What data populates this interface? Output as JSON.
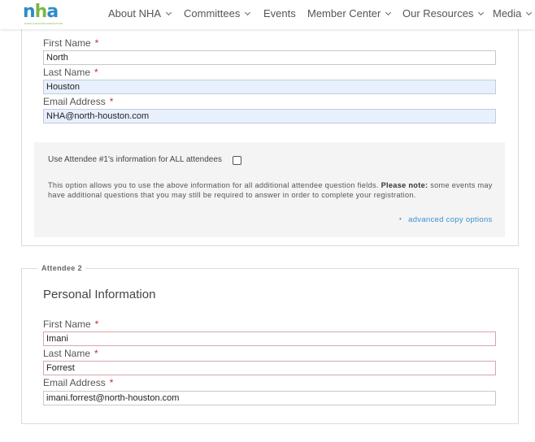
{
  "header": {
    "logo_text": "nha",
    "logo_subtext": "NORTH HOUSTON ASSOCIATION",
    "nav": [
      {
        "label": "About NHA",
        "has_dropdown": true
      },
      {
        "label": "Committees",
        "has_dropdown": true
      },
      {
        "label": "Events",
        "has_dropdown": false
      },
      {
        "label": "Member Center",
        "has_dropdown": true
      },
      {
        "label": "Our Resources",
        "has_dropdown": true
      },
      {
        "label": "Media",
        "has_dropdown": true
      }
    ]
  },
  "attendee1": {
    "first_name_label": "First Name",
    "first_name_value": "North",
    "last_name_label": "Last Name",
    "last_name_value": "Houston",
    "email_label": "Email Address",
    "email_value": "NHA@north-houston.com",
    "required_mark": "*"
  },
  "copy_options": {
    "checkbox_label": "Use Attendee #1's information for ALL attendees",
    "checkbox_checked": false,
    "description_part1": "This option allows you to use the above information for all additional attendee question fields.",
    "description_note_label": "Please note:",
    "description_part2": "some events may have additional questions that you may still be required to answer in order to complete your registration.",
    "advanced_link": "advanced copy options",
    "bullet": "•"
  },
  "attendee2": {
    "legend": "Attendee 2",
    "section_title": "Personal Information",
    "first_name_label": "First Name",
    "first_name_value": "Imani",
    "last_name_label": "Last Name",
    "last_name_value": "Forrest",
    "email_label": "Email Address",
    "email_value": "imani.forrest@north-houston.com",
    "required_mark": "*"
  },
  "colors": {
    "accent_link": "#3a8fd0",
    "required": "#cc2b2b",
    "autofill_bg": "#e8f0fe",
    "logo_blue": "#2e8bc9",
    "logo_green": "#7cb642"
  }
}
